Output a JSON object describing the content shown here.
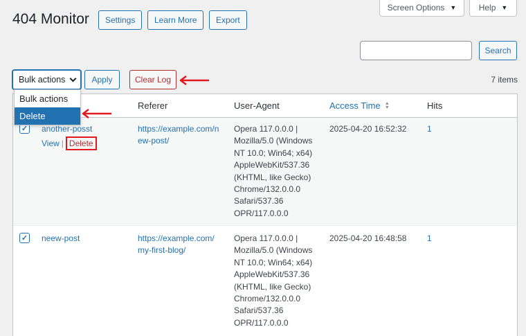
{
  "header": {
    "title": "404 Monitor",
    "buttons": {
      "settings": "Settings",
      "learn_more": "Learn More",
      "export": "Export"
    },
    "screen_options": "Screen Options",
    "help": "Help"
  },
  "search": {
    "value": "",
    "button": "Search"
  },
  "toolbar": {
    "bulk_selected": "Bulk actions",
    "bulk_options": [
      "Bulk actions",
      "Delete"
    ],
    "apply": "Apply",
    "clear_log": "Clear Log",
    "item_count": "7 items"
  },
  "table": {
    "columns": {
      "referer": "Referer",
      "user_agent": "User-Agent",
      "access_time": "Access Time",
      "hits": "Hits"
    },
    "rows": [
      {
        "uri": "another-posst",
        "referer_lines": [
          "https://example.com/n",
          "ew-post/"
        ],
        "ua_lines": [
          "Opera 117.0.0.0 |",
          "Mozilla/5.0 (Windows",
          "NT 10.0; Win64; x64)",
          "AppleWebKit/537.36",
          "(KHTML, like Gecko)",
          "Chrome/132.0.0.0",
          "Safari/537.36",
          "OPR/117.0.0.0"
        ],
        "access_time": "2025-04-20 16:52:32",
        "hits": "1",
        "actions": {
          "view": "View",
          "sep": "|",
          "delete": "Delete"
        },
        "checked": true
      },
      {
        "uri": "neew-post",
        "referer_lines": [
          "https://example.com/",
          "my-first-blog/"
        ],
        "ua_lines": [
          "Opera 117.0.0.0 |",
          "Mozilla/5.0 (Windows",
          "NT 10.0; Win64; x64)",
          "AppleWebKit/537.36",
          "(KHTML, like Gecko)",
          "Chrome/132.0.0.0",
          "Safari/537.36",
          "OPR/117.0.0.0"
        ],
        "access_time": "2025-04-20 16:48:58",
        "hits": "1",
        "checked": true
      }
    ]
  },
  "colors": {
    "accent": "#2271b1",
    "danger": "#b32d2e",
    "annotation": "#e0191f"
  }
}
